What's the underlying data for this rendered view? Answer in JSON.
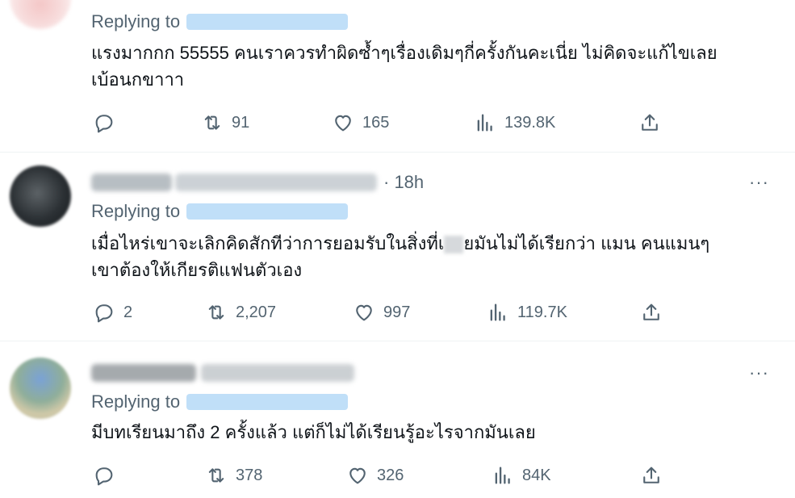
{
  "tweets": [
    {
      "replying_to": "Replying to",
      "text": "แรงมากกก 55555 คนเราควรทำผิดซ้ำๆเรื่องเดิมๆกี่ครั้งกันคะเนี่ย ไม่คิดจะแก้ไขเลย\nเบ้อนกขาาา",
      "replies": "",
      "retweets": "91",
      "likes": "165",
      "views": "139.8K"
    },
    {
      "time": "· 18h",
      "more": "···",
      "replying_to": "Replying to",
      "text_before": "เมื่อไหร่เขาจะเลิกคิดสักทีว่าการยอมรับในสิ่งที่เ",
      "text_after": "ยมันไม่ได้เรียกว่า แมน คนแมนๆ\nเขาต้องให้เกียรติแฟนตัวเอง",
      "replies": "2",
      "retweets": "2,207",
      "likes": "997",
      "views": "119.7K"
    },
    {
      "more": "···",
      "replying_to": "Replying to",
      "text": "มีบทเรียนมาถึง 2 ครั้งแล้ว แต่ก็ไม่ได้เรียนรู้อะไรจากมันเลย",
      "replies": "",
      "retweets": "378",
      "likes": "326",
      "views": "84K"
    }
  ],
  "icons": [
    "reply-icon",
    "retweet-icon",
    "like-icon",
    "views-icon",
    "share-icon"
  ],
  "colors": {
    "text": "#0f1419",
    "secondary": "#536471",
    "divider": "#eff3f4",
    "handle_blur": "#b9dcf7"
  }
}
